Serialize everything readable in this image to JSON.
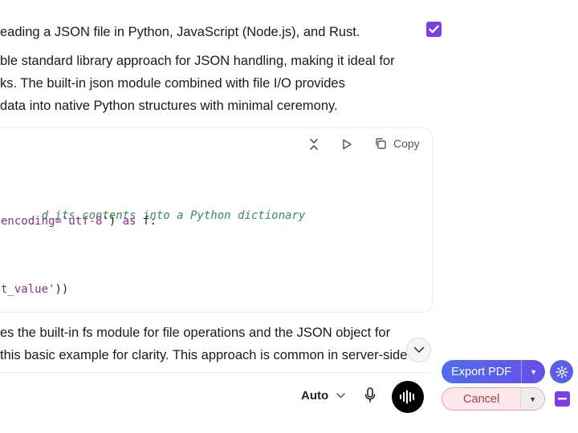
{
  "prose": {
    "intro": "eading a JSON file in Python, JavaScript (Node.js), and Rust.",
    "python_desc": [
      "ble standard library approach for JSON handling, making it ideal for",
      "ks. The built-in json module combined with file I/O provides",
      "data into native Python structures with minimal ceremony."
    ],
    "node_desc": [
      "es the built-in fs module for file operations and the JSON object for",
      "this basic example for clarity. This approach is common in server-side"
    ]
  },
  "code_block": {
    "toolbar": {
      "collapse_icon": "collapse-icon",
      "run_icon": "play-icon",
      "copy_icon": "copy-icon",
      "copy_label": "Copy"
    },
    "lines": [
      {
        "text": "d its contents into a Python dictionary",
        "kind": "comment"
      },
      {
        "parts": [
          "encoding=",
          "'utf-8'",
          ") ",
          "as",
          " f:"
        ]
      },
      {
        "parts": [
          "t_value'",
          "))"
        ]
      }
    ]
  },
  "composer": {
    "model_label": "Auto",
    "mic_icon": "microphone-icon",
    "voice_icon": "voice-waveform-icon"
  },
  "actions": {
    "export_label": "Export PDF",
    "cancel_label": "Cancel"
  },
  "colors": {
    "accent_purple": "#7b3fe4",
    "export_gradient_start": "#4f6cf0",
    "export_gradient_end": "#6550e8",
    "cancel_text": "#c2344a",
    "cancel_bg": "#fde9ec"
  }
}
